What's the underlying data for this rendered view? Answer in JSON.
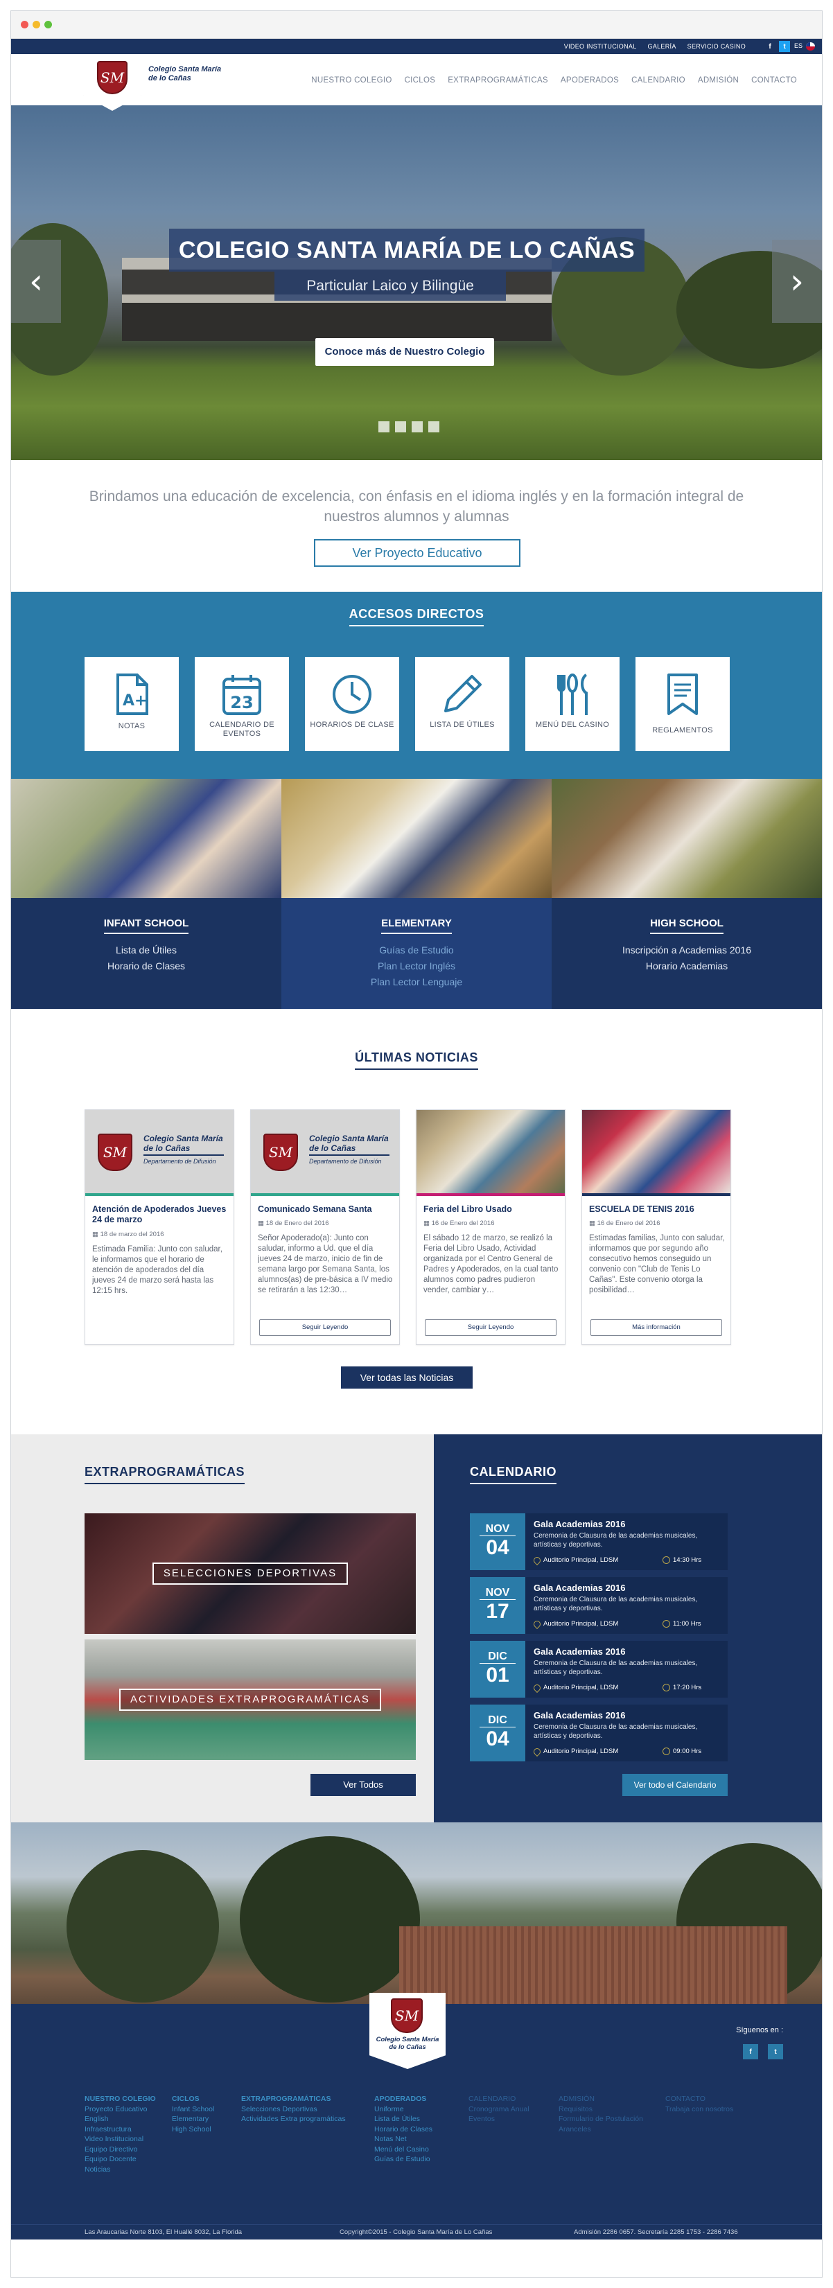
{
  "topbar": {
    "links": [
      "VIDEO INSTITUCIONAL",
      "GALERÍA",
      "SERVICIO CASINO"
    ],
    "lang": "ES"
  },
  "brand": {
    "monogram": "SM",
    "name_line1": "Colegio Santa María",
    "name_line2": "de lo Cañas"
  },
  "nav": [
    "NUESTRO COLEGIO",
    "CICLOS",
    "EXTRAPROGRAMÁTICAS",
    "APODERADOS",
    "CALENDARIO",
    "ADMISIÓN",
    "CONTACTO"
  ],
  "hero": {
    "title": "COLEGIO SANTA MARÍA DE LO CAÑAS",
    "subtitle": "Particular Laico y Bilingüe",
    "button": "Conoce más de Nuestro Colegio",
    "prev_icon": "chevron-left-icon",
    "next_icon": "chevron-right-icon"
  },
  "intro": {
    "text": "Brindamos una educación de excelencia, con énfasis en el idioma inglés y en la formación integral de nuestros alumnos y alumnas",
    "button": "Ver Proyecto Educativo"
  },
  "access": {
    "title": "ACCESOS DIRECTOS",
    "tiles": [
      {
        "label": "NOTAS",
        "icon": "grade-document-icon"
      },
      {
        "label": "CALENDARIO DE EVENTOS",
        "icon": "calendar-icon",
        "number": "23"
      },
      {
        "label": "HORARIOS DE CLASE",
        "icon": "clock-icon"
      },
      {
        "label": "LISTA DE ÚTILES",
        "icon": "pencil-icon"
      },
      {
        "label": "MENÚ DEL CASINO",
        "icon": "cutlery-icon"
      },
      {
        "label": "REGLAMENTOS",
        "icon": "bookmark-icon"
      }
    ]
  },
  "schools": [
    {
      "title": "INFANT SCHOOL",
      "links": [
        "Lista de Útiles",
        "Horario de Clases"
      ]
    },
    {
      "title": "ELEMENTARY",
      "links": [
        "Guías de Estudio",
        "Plan Lector Inglés",
        "Plan Lector Lenguaje"
      ]
    },
    {
      "title": "HIGH SCHOOL",
      "links": [
        "Inscripción a Academias 2016",
        "Horario Academias"
      ]
    }
  ],
  "news": {
    "title": "ÚLTIMAS NOTICIAS",
    "cards": [
      {
        "title": "Atención de Apoderados Jueves 24 de marzo",
        "date": "18 de marzo del 2016",
        "text": "Estimada Familia: Junto con saludar, le informamos que el horario de atención de apoderados del día jueves 24 de marzo será hasta las 12:15 hrs.",
        "button": "",
        "logo_line1": "Colegio Santa María",
        "logo_line2": "de lo Cañas",
        "dept": "Departamento de Difusión"
      },
      {
        "title": "Comunicado Semana Santa",
        "date": "18 de Enero del 2016",
        "text": "Señor Apoderado(a): Junto con saludar, informo a Ud. que el día jueves 24 de marzo, inicio de fin de semana largo por Semana Santa, los alumnos(as) de pre-básica a IV medio se retirarán a las 12:30…",
        "button": "Seguir Leyendo",
        "logo_line1": "Colegio Santa María",
        "logo_line2": "de lo Cañas",
        "dept": "Departamento de Difusión"
      },
      {
        "title": "Feria del Libro Usado",
        "date": "16 de Enero del 2016",
        "text": "El sábado 12 de marzo, se realizó la Feria del Libro Usado, Actividad organizada por el Centro General de Padres y Apoderados, en la cual tanto alumnos como padres pudieron vender, cambiar y…",
        "button": "Seguir Leyendo"
      },
      {
        "title": "ESCUELA DE TENIS 2016",
        "date": "16 de Enero del 2016",
        "text": "Estimadas familias, Junto con saludar, informamos que por segundo año consecutivo hemos conseguido un convenio con \"Club de Tenis Lo Cañas\". Este convenio otorga la posibilidad…",
        "button": "Más información"
      }
    ],
    "all_button": "Ver todas las Noticias"
  },
  "extra": {
    "title": "EXTRAPROGRAMÁTICAS",
    "items": [
      "SELECCIONES DEPORTIVAS",
      "ACTIVIDADES EXTRAPROGRAMÁTICAS"
    ],
    "button": "Ver Todos"
  },
  "calendar": {
    "title": "CALENDARIO",
    "events": [
      {
        "month": "NOV",
        "day": "04",
        "title": "Gala Academias 2016",
        "desc": "Ceremonia de Clausura de las academias musicales, artísticas y deportivas.",
        "location": "Auditorio Principal, LDSM",
        "time": "14:30 Hrs"
      },
      {
        "month": "NOV",
        "day": "17",
        "title": "Gala Academias 2016",
        "desc": "Ceremonia de Clausura de las academias musicales, artísticas y deportivas.",
        "location": "Auditorio Principal, LDSM",
        "time": "11:00 Hrs"
      },
      {
        "month": "DIC",
        "day": "01",
        "title": "Gala Academias 2016",
        "desc": "Ceremonia de Clausura de las academias musicales, artísticas y deportivas.",
        "location": "Auditorio Principal, LDSM",
        "time": "17:20 Hrs"
      },
      {
        "month": "DIC",
        "day": "04",
        "title": "Gala Academias 2016",
        "desc": "Ceremonia de Clausura de las academias musicales, artísticas y deportivas.",
        "location": "Auditorio Principal, LDSM",
        "time": "09:00 Hrs"
      }
    ],
    "button": "Ver todo el Calendario"
  },
  "footer": {
    "follow": "Síguenos en :",
    "columns": [
      {
        "heading": "NUESTRO COLEGIO",
        "items": [
          "Proyecto Educativo",
          "English",
          "Infraestructura",
          "Video Institucional",
          "Equipo Directivo",
          "Equipo Docente",
          "Noticias"
        ]
      },
      {
        "heading": "CICLOS",
        "items": [
          "Infant School",
          "Elementary",
          "High School"
        ]
      },
      {
        "heading": "EXTRAPROGRAMÁTICAS",
        "items": [
          "Selecciones Deportivas",
          "Actividades Extra programáticas"
        ]
      },
      {
        "heading": "APODERADOS",
        "items": [
          "Uniforme",
          "Lista de Útiles",
          "Horario de Clases",
          "Notas Net",
          "Menú del Casino",
          "Guías de Estudio"
        ]
      },
      {
        "heading": "",
        "items": [
          "CALENDARIO",
          "Cronograma Anual",
          "Eventos"
        ]
      },
      {
        "heading": "",
        "items": [
          "ADMISIÓN",
          "Requisitos",
          "Formulario de Postulación",
          "Aranceles"
        ]
      },
      {
        "heading": "",
        "items": [
          "CONTACTO",
          "Trabaja con nosotros"
        ]
      }
    ],
    "address": "Las Araucarias Norte 8103, El Huallé 8032, La Florida",
    "copyright": "Copyright©2015 - Colegio Santa María de Lo Cañas",
    "phones": "Admisión 2286 0657. Secretaría 2285 1753 - 2286 7436"
  },
  "colors": {
    "navy": "#1b3360",
    "blue": "#2a7ba8",
    "crimson": "#9c1c23"
  }
}
